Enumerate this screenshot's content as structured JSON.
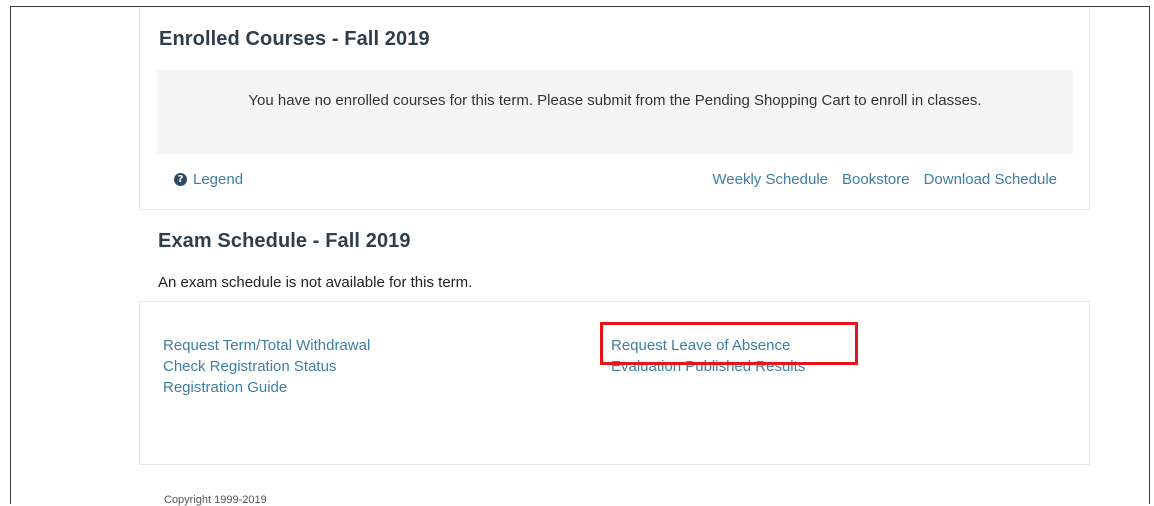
{
  "enrolled": {
    "title": "Enrolled Courses - Fall 2019",
    "notice": "You have no enrolled courses for this term. Please submit from the Pending Shopping Cart to enroll in classes.",
    "legend_label": "Legend",
    "legend_icon": "question-circle-icon",
    "links": {
      "weekly_schedule": "Weekly Schedule",
      "bookstore": "Bookstore",
      "download_schedule": "Download Schedule"
    }
  },
  "exam": {
    "title": "Exam Schedule - Fall 2019",
    "message": "An exam schedule is not available for this term."
  },
  "quick_links": {
    "left": [
      "Request Term/Total Withdrawal",
      "Check Registration Status",
      "Registration Guide"
    ],
    "right": [
      "Request Leave of Absence",
      "Evaluation Published Results"
    ]
  },
  "footer": {
    "copyright": "Copyright 1999-2019"
  },
  "colors": {
    "link": "#3d7ea6",
    "heading": "#2f3e4b",
    "highlight": "#e8141b"
  }
}
